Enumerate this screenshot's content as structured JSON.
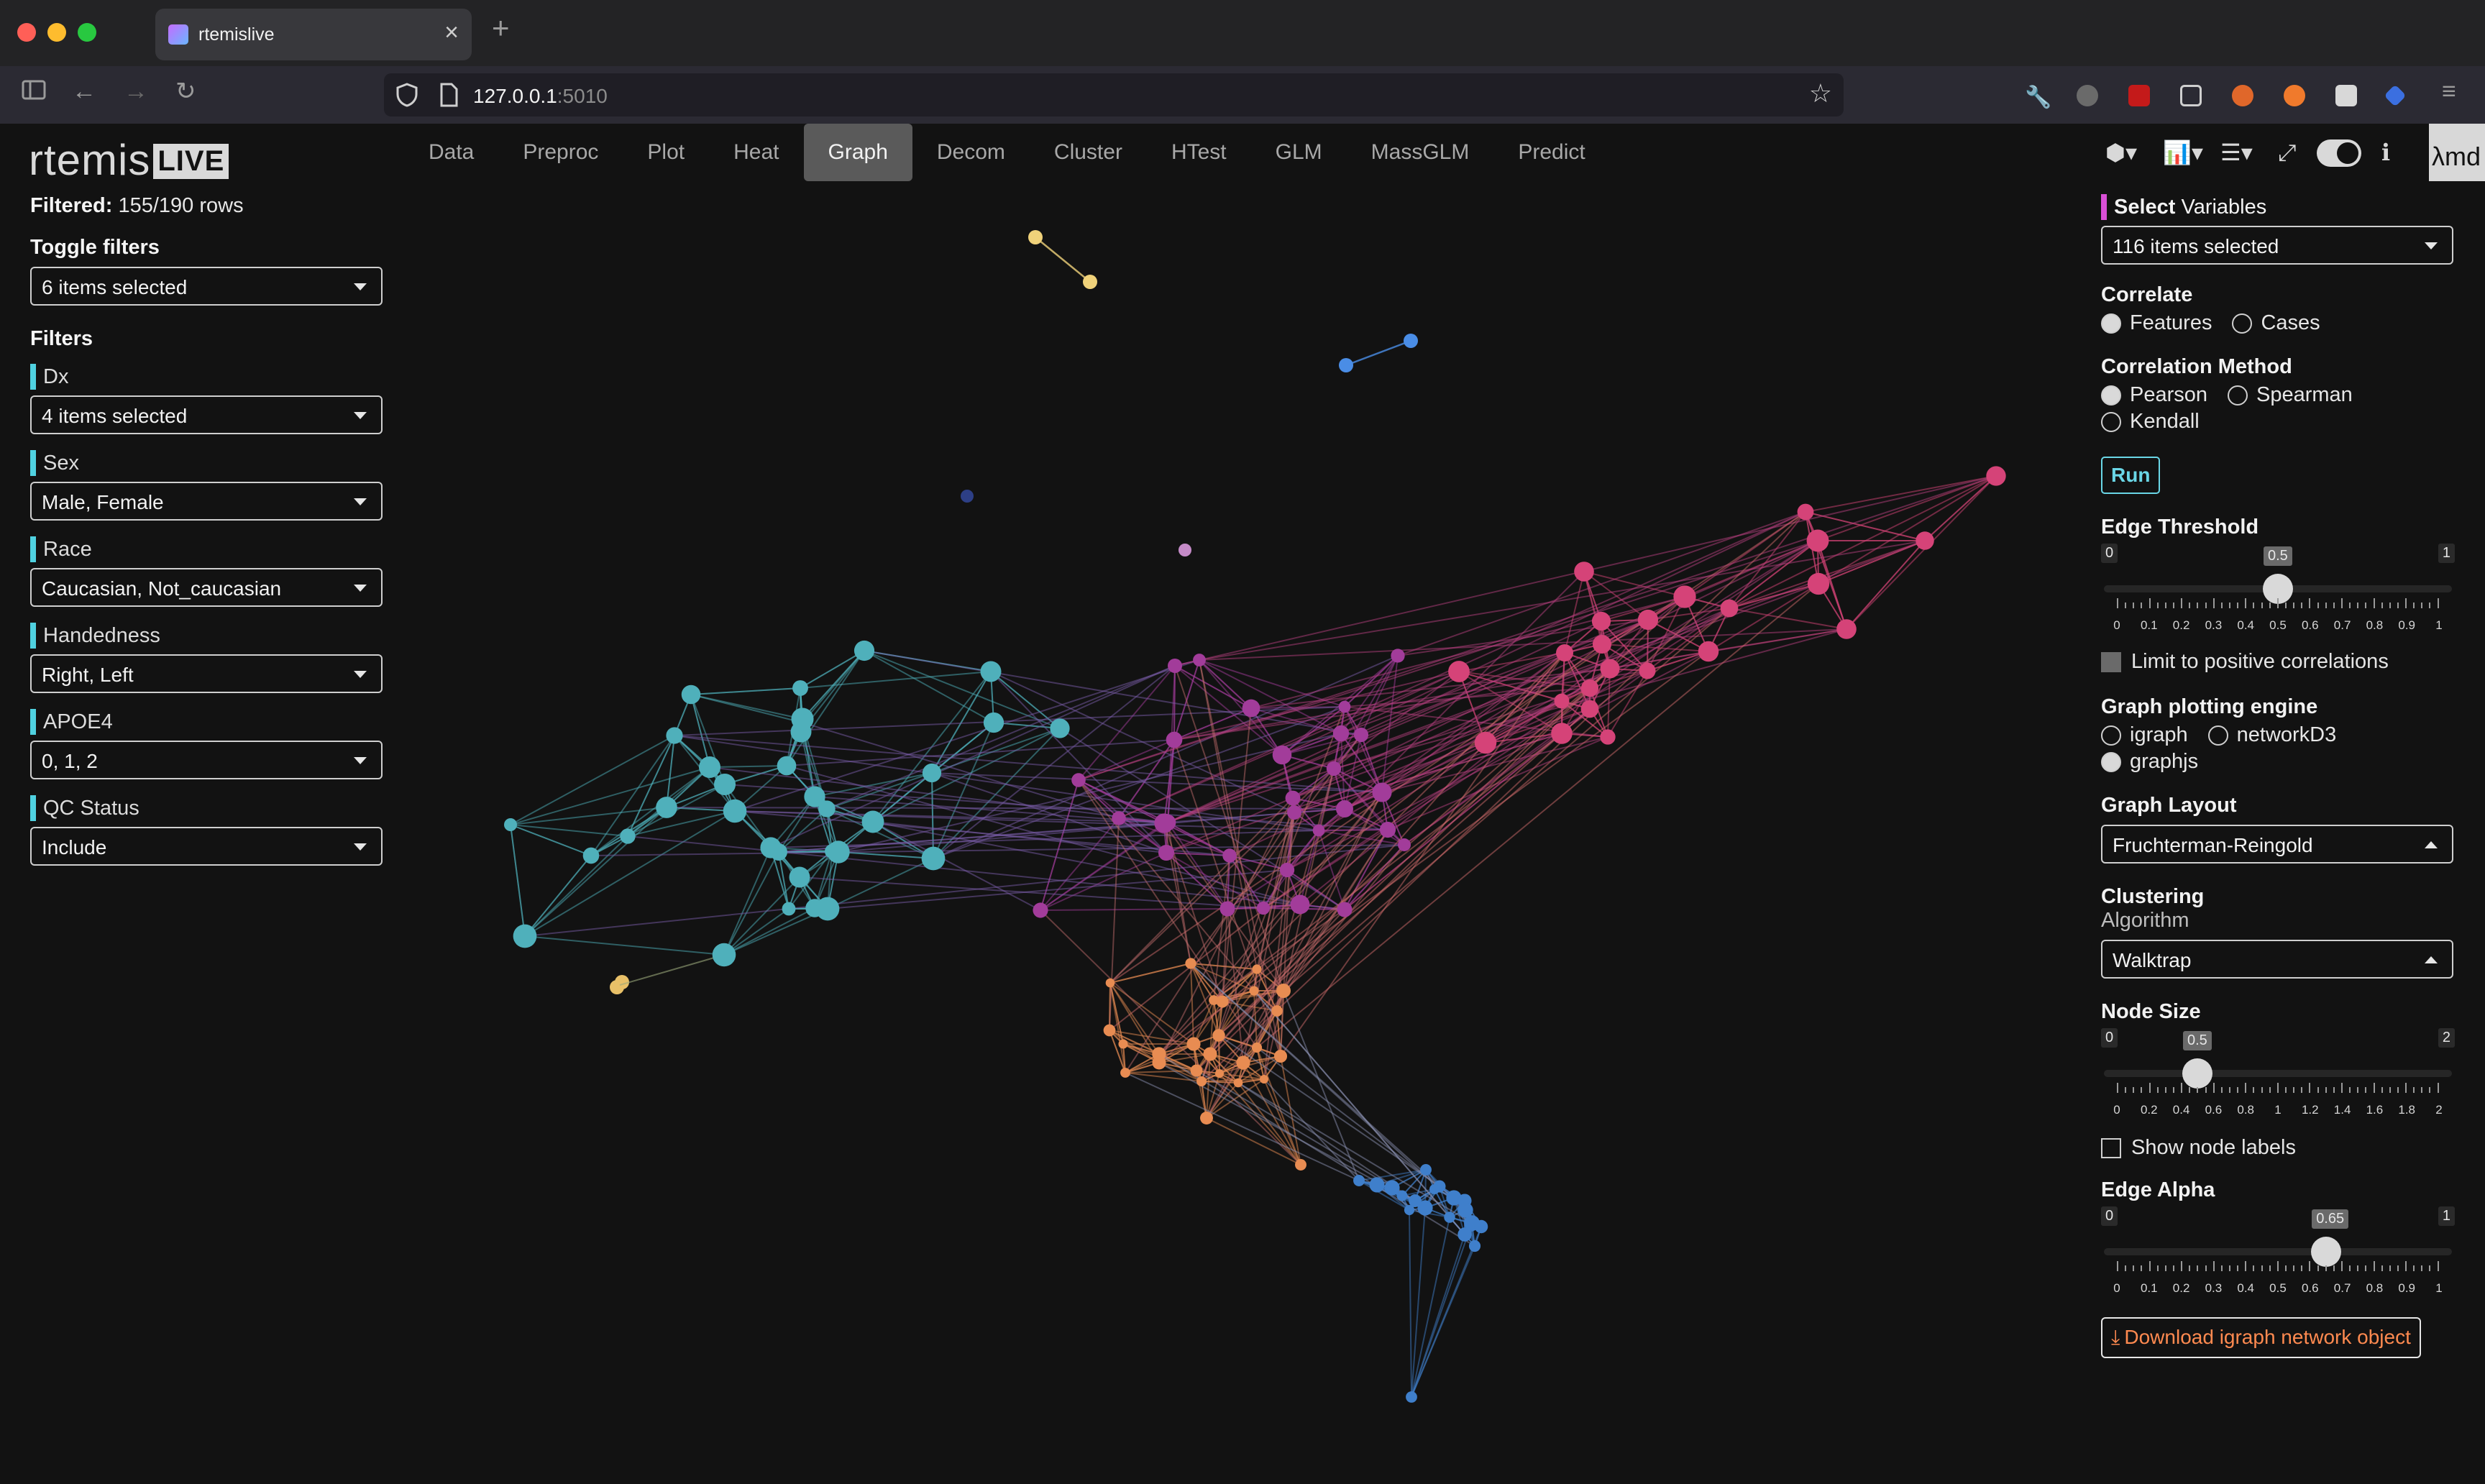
{
  "browser": {
    "tab_title": "rtemislive",
    "url_host": "127.0.0.1",
    "url_port": ":5010"
  },
  "app": {
    "logo_text": "rtemis",
    "logo_badge": "LIVE",
    "nav_tabs": [
      "Data",
      "Preproc",
      "Plot",
      "Heat",
      "Graph",
      "Decom",
      "Cluster",
      "HTest",
      "GLM",
      "MassGLM",
      "Predict"
    ],
    "active_tab": "Graph",
    "lambda_text": "λmd"
  },
  "left": {
    "filtered_label": "Filtered:",
    "filtered_value": "155/190 rows",
    "toggle_filters_label": "Toggle filters",
    "toggle_filters_value": "6 items selected",
    "filters_label": "Filters",
    "filters": [
      {
        "label": "Dx",
        "value": "4 items selected"
      },
      {
        "label": "Sex",
        "value": "Male, Female"
      },
      {
        "label": "Race",
        "value": "Caucasian, Not_caucasian"
      },
      {
        "label": "Handedness",
        "value": "Right, Left"
      },
      {
        "label": "APOE4",
        "value": "0, 1, 2"
      },
      {
        "label": "QC Status",
        "value": "Include"
      }
    ]
  },
  "right": {
    "select_variables_bold": "Select",
    "select_variables_rest": " Variables",
    "select_variables_value": "116 items selected",
    "correlate_label": "Correlate",
    "correlate_options": [
      "Features",
      "Cases"
    ],
    "correlate_selected": "Features",
    "method_label": "Correlation Method",
    "method_options": [
      "Pearson",
      "Spearman",
      "Kendall"
    ],
    "method_selected": "Pearson",
    "run_label": "Run",
    "edge_threshold_label": "Edge Threshold",
    "edge_threshold": {
      "min": "0",
      "max": "1",
      "value": 0.5,
      "value_text": "0.5",
      "ticks": [
        "0",
        "0.1",
        "0.2",
        "0.3",
        "0.4",
        "0.5",
        "0.6",
        "0.7",
        "0.8",
        "0.9",
        "1"
      ]
    },
    "limit_positive_label": "Limit to positive correlations",
    "engine_label": "Graph plotting engine",
    "engine_options": [
      "igraph",
      "networkD3",
      "graphjs"
    ],
    "engine_selected": "graphjs",
    "layout_label": "Graph Layout",
    "layout_value": "Fruchterman-Reingold",
    "clustering_label": "Clustering",
    "algorithm_label": "Algorithm",
    "algorithm_value": "Walktrap",
    "node_size_label": "Node Size",
    "node_size": {
      "min": "0",
      "max": "2",
      "value": 0.5,
      "value_text": "0.5",
      "ticks": [
        "0",
        "0.2",
        "0.4",
        "0.6",
        "0.8",
        "1",
        "1.2",
        "1.4",
        "1.6",
        "1.8",
        "2"
      ]
    },
    "show_labels_label": "Show node labels",
    "edge_alpha_label": "Edge Alpha",
    "edge_alpha": {
      "min": "0",
      "max": "1",
      "value": 0.65,
      "value_text": "0.65",
      "ticks": [
        "0",
        "0.1",
        "0.2",
        "0.3",
        "0.4",
        "0.5",
        "0.6",
        "0.7",
        "0.8",
        "0.9",
        "1"
      ]
    },
    "download_label": "Download igraph network object"
  },
  "graph": {
    "cluster_colors": {
      "teal": "#4fb0bb",
      "purple": "#a23c9a",
      "pink": "#d54378",
      "orange": "#e88c52",
      "blue": "#3f7fcb",
      "yellow": "#f0d27a",
      "lightblue": "#4a8de6",
      "navy": "#2d3f86",
      "mauve": "#c58bc8",
      "gold": "#e8c068"
    }
  }
}
